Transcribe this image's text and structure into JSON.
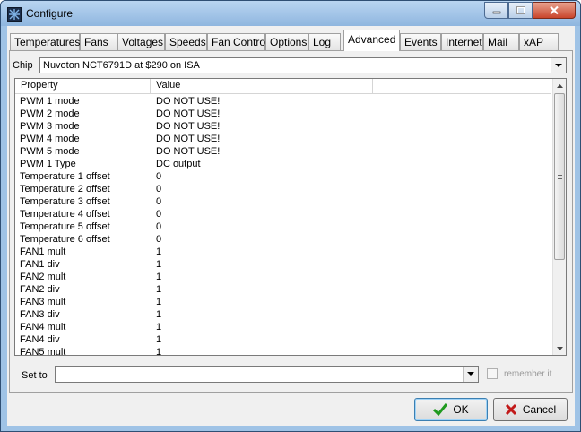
{
  "window": {
    "title": "Configure"
  },
  "tabs": [
    {
      "label": "Temperatures"
    },
    {
      "label": "Fans"
    },
    {
      "label": "Voltages"
    },
    {
      "label": "Speeds"
    },
    {
      "label": "Fan Control"
    },
    {
      "label": "Options"
    },
    {
      "label": "Log"
    },
    {
      "label": "Advanced",
      "active": true
    },
    {
      "label": "Events"
    },
    {
      "label": "Internet"
    },
    {
      "label": "Mail"
    },
    {
      "label": "xAP"
    }
  ],
  "chip": {
    "label": "Chip",
    "value": "Nuvoton NCT6791D at $290 on ISA"
  },
  "grid": {
    "columns": [
      "Property",
      "Value"
    ],
    "rows": [
      {
        "property": "PWM 1 mode",
        "value": "DO NOT USE!"
      },
      {
        "property": "PWM 2 mode",
        "value": "DO NOT USE!"
      },
      {
        "property": "PWM 3 mode",
        "value": "DO NOT USE!"
      },
      {
        "property": "PWM 4 mode",
        "value": "DO NOT USE!"
      },
      {
        "property": "PWM 5 mode",
        "value": "DO NOT USE!"
      },
      {
        "property": "PWM 1 Type",
        "value": "DC output"
      },
      {
        "property": "Temperature 1 offset",
        "value": "0"
      },
      {
        "property": "Temperature 2 offset",
        "value": "0"
      },
      {
        "property": "Temperature 3 offset",
        "value": "0"
      },
      {
        "property": "Temperature 4 offset",
        "value": "0"
      },
      {
        "property": "Temperature 5 offset",
        "value": "0"
      },
      {
        "property": "Temperature 6 offset",
        "value": "0"
      },
      {
        "property": "FAN1 mult",
        "value": "1"
      },
      {
        "property": "FAN1 div",
        "value": "1"
      },
      {
        "property": "FAN2 mult",
        "value": "1"
      },
      {
        "property": "FAN2 div",
        "value": "1"
      },
      {
        "property": "FAN3 mult",
        "value": "1"
      },
      {
        "property": "FAN3 div",
        "value": "1"
      },
      {
        "property": "FAN4 mult",
        "value": "1"
      },
      {
        "property": "FAN4 div",
        "value": "1"
      },
      {
        "property": "FAN5 mult",
        "value": "1"
      }
    ]
  },
  "set_to": {
    "label": "Set to",
    "value": ""
  },
  "remember": {
    "label": "remember it",
    "checked": false
  },
  "buttons": {
    "ok": "OK",
    "cancel": "Cancel"
  },
  "colors": {
    "titlebar": "#9fc3e6",
    "ok_icon": "#1f9a1f",
    "cancel_icon": "#c21a1a"
  }
}
